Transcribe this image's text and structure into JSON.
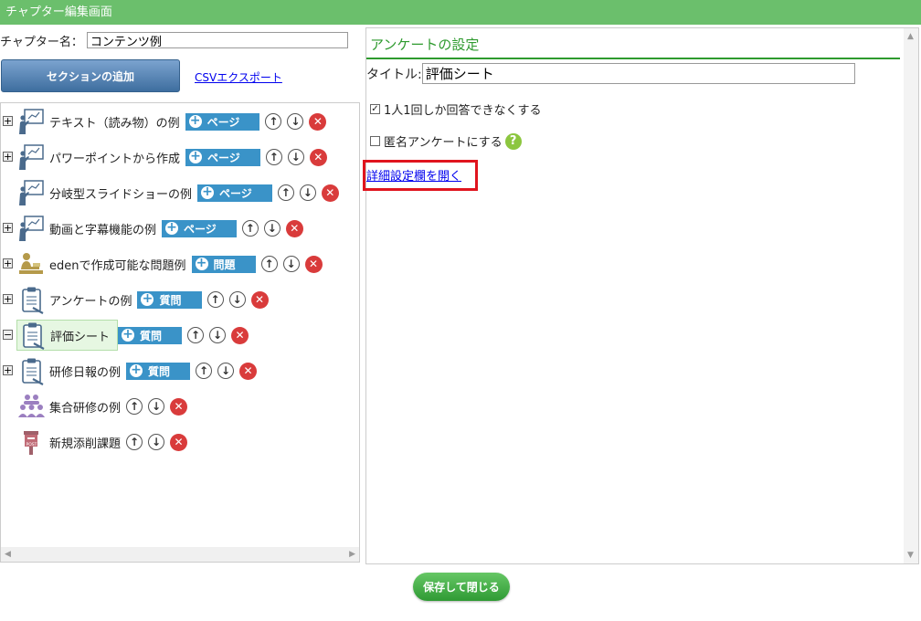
{
  "titlebar": {
    "title": "チャプター編集画面"
  },
  "chapter": {
    "label": "チャプター名：",
    "value": "コンテンツ例"
  },
  "toolbar": {
    "add_section_label": "セクションの追加",
    "csv_export_label": "CSVエクスポート"
  },
  "tree": {
    "items": [
      {
        "label": "テキスト（読み物）の例",
        "icon": "presentation-icon",
        "button": "ページ",
        "expander": "+"
      },
      {
        "label": "パワーポイントから作成",
        "icon": "presentation-icon",
        "button": "ページ",
        "expander": "+"
      },
      {
        "label": "分岐型スライドショーの例",
        "icon": "presentation-icon",
        "button": "ページ",
        "expander": ""
      },
      {
        "label": "動画と字幕機能の例",
        "icon": "presentation-icon",
        "button": "ページ",
        "expander": "+"
      },
      {
        "label": "edenで作成可能な問題例",
        "icon": "exam-icon",
        "button": "問題",
        "expander": "+"
      },
      {
        "label": "アンケートの例",
        "icon": "clipboard-icon",
        "button": "質問",
        "expander": "+"
      },
      {
        "label": "評価シート",
        "icon": "clipboard-icon",
        "button": "質問",
        "expander": "−",
        "selected": true
      },
      {
        "label": "研修日報の例",
        "icon": "clipboard-icon",
        "button": "質問",
        "expander": "+"
      },
      {
        "label": "集合研修の例",
        "icon": "group-icon",
        "button": "",
        "expander": ""
      },
      {
        "label": "新規添削課題",
        "icon": "postbox-icon",
        "button": "",
        "expander": ""
      }
    ]
  },
  "survey": {
    "heading": "アンケートの設定",
    "title_label": "タイトル:",
    "title_value": "評価シート",
    "one_answer_label": "1人1回しか回答できなくする",
    "one_answer_checked": true,
    "anonymous_label": "匿名アンケートにする",
    "anonymous_checked": false,
    "advanced_link": "詳細設定欄を開く"
  },
  "footer": {
    "save_label": "保存して閉じる"
  },
  "colors": {
    "titlebar": "#6bbf6c",
    "accent_blue": "#3a93c8",
    "highlight_red": "#e0141e",
    "heading_green": "#2e9a2e"
  }
}
